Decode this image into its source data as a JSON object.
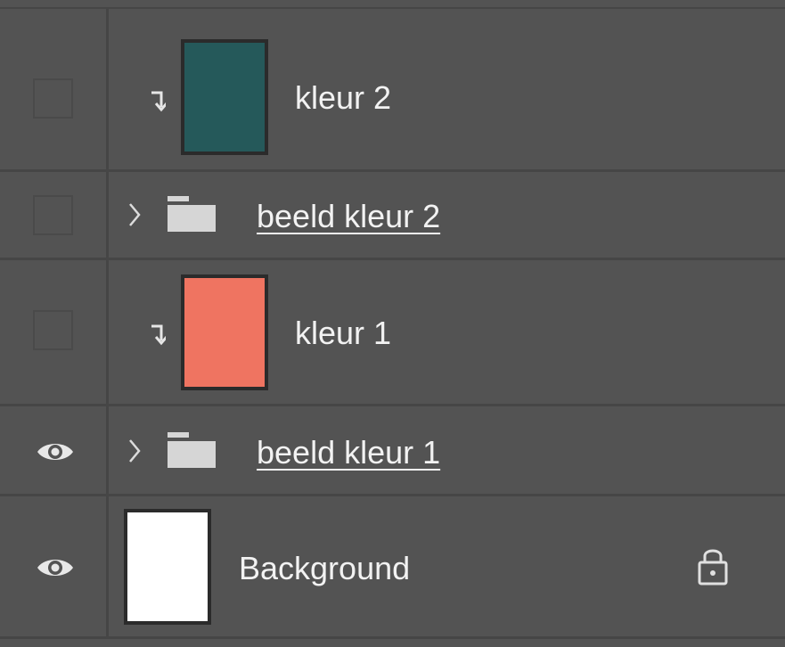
{
  "layers": [
    {
      "name": "kleur 2",
      "type": "fill",
      "visible": false,
      "clipped": true,
      "thumbnail_color": "#25595a"
    },
    {
      "name": "beeld kleur 2",
      "type": "group",
      "visible": false,
      "collapsed": true
    },
    {
      "name": "kleur 1",
      "type": "fill",
      "visible": false,
      "clipped": true,
      "thumbnail_color": "#ef7461"
    },
    {
      "name": "beeld kleur 1",
      "type": "group",
      "visible": true,
      "collapsed": true
    },
    {
      "name": "Background",
      "type": "background",
      "visible": true,
      "locked": true,
      "thumbnail_color": "#ffffff"
    }
  ],
  "icons": {
    "visibility": "eye-icon",
    "clipping": "clipping-arrow-icon",
    "expand": "chevron-right-icon",
    "group": "folder-icon",
    "lock": "lock-icon"
  },
  "colors": {
    "panel_bg": "#535353",
    "divider": "#464646",
    "text": "#f2f2f2",
    "icon": "#dcdcdc"
  }
}
